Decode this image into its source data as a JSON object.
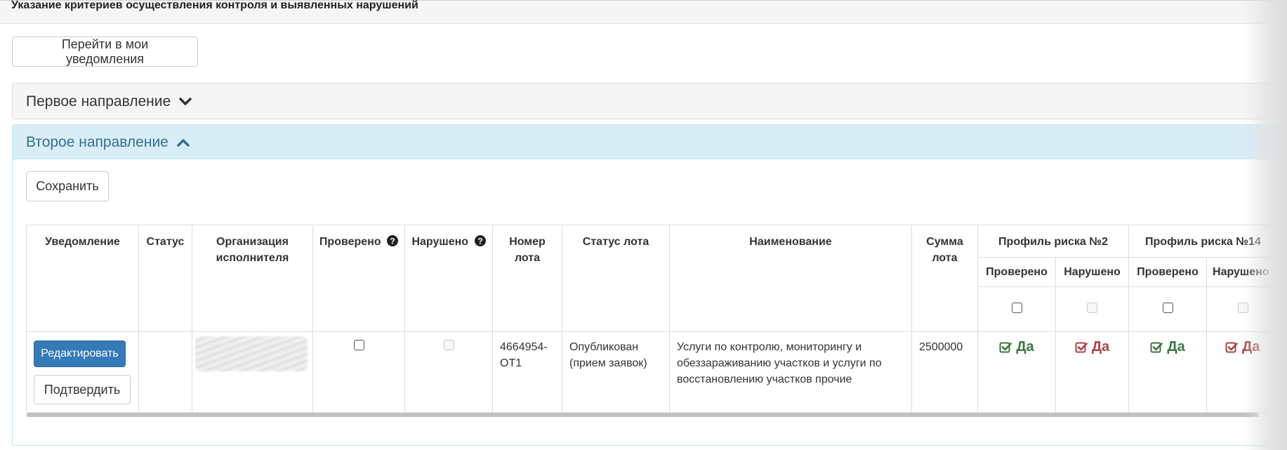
{
  "page": {
    "title": "Указание критериев осуществления контроля и выявленных нарушений",
    "goto_notifications_label": "Перейти в мои уведомления"
  },
  "panels": {
    "first": {
      "title": "Первое направление",
      "state": "collapsed",
      "icon": "chevron-down-icon"
    },
    "second": {
      "title": "Второе направление",
      "state": "expanded",
      "icon": "chevron-up-icon"
    }
  },
  "save_label": "Сохранить",
  "table": {
    "headers": {
      "notification": "Уведомление",
      "status": "Статус",
      "org": "Организация исполнителя",
      "checked": "Проверено",
      "violated": "Нарушено",
      "lot_number": "Номер лота",
      "lot_status": "Статус лота",
      "name": "Наименование",
      "lot_sum": "Сумма лота",
      "risk_profiles": [
        {
          "title": "Профиль риска №2",
          "checked": "Проверено",
          "violated": "Нарушено"
        },
        {
          "title": "Профиль риска №14",
          "checked": "Проверено",
          "violated": "Нарушено"
        }
      ]
    },
    "row": {
      "edit_label": "Редактировать",
      "confirm_label": "Подтвердить",
      "status": "",
      "lot_number": "4664954-ОТ1",
      "lot_status": "Опубликован (прием заявок)",
      "name": "Услуги по контролю, мониторингу и обеззараживанию участков и услуги по восстановлению участков прочие",
      "lot_sum": "2500000",
      "risk_values": [
        {
          "label": "Да",
          "color": "#3c763d"
        },
        {
          "label": "Да",
          "color": "#a94442"
        },
        {
          "label": "Да",
          "color": "#3c763d"
        },
        {
          "label": "Да",
          "color": "#a94442"
        }
      ]
    }
  },
  "colors": {
    "primary": "#337ab7",
    "info_panel_bg": "#d9edf7",
    "info_panel_text": "#31708f",
    "success": "#3c763d",
    "danger": "#a94442"
  }
}
